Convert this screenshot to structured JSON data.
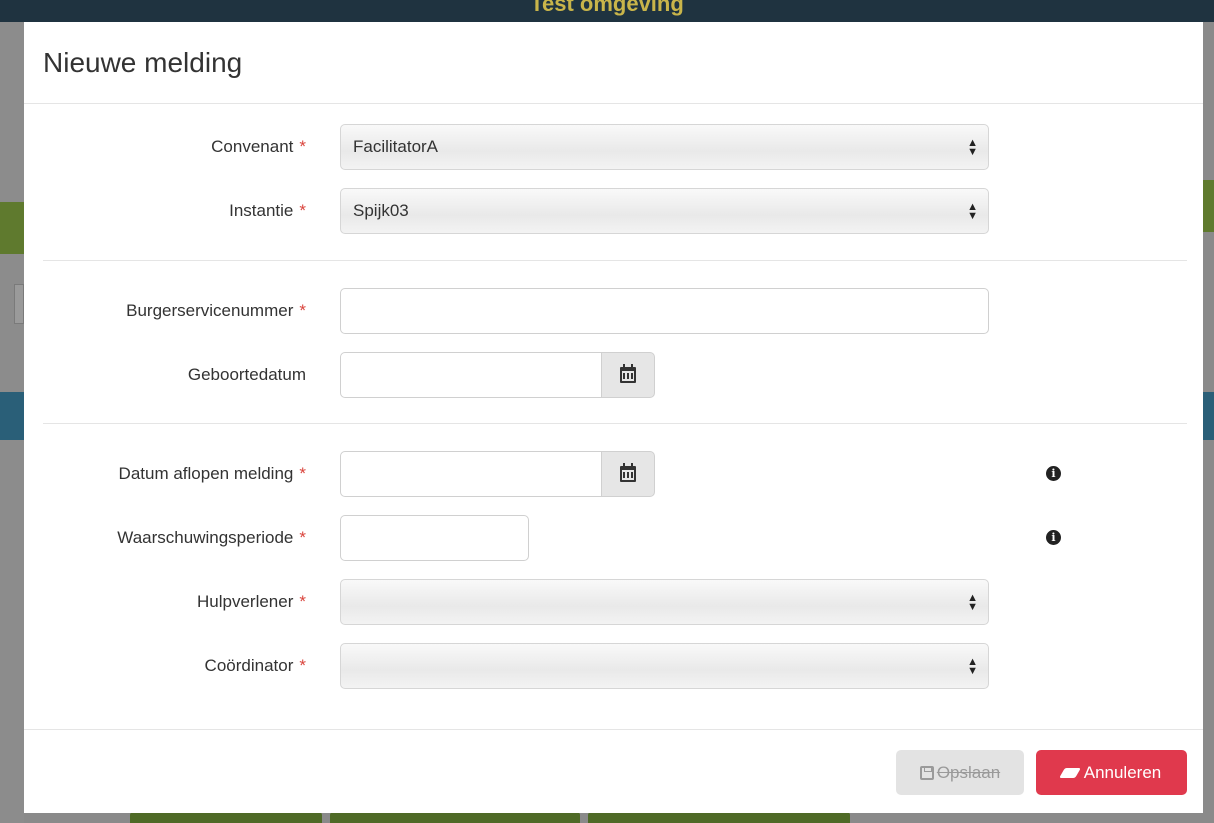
{
  "background": {
    "environment_label": "Test omgeving"
  },
  "modal": {
    "title": "Nieuwe melding",
    "required_marker": "*",
    "fields": {
      "convenant": {
        "label": "Convenant",
        "value": "FacilitatorA"
      },
      "instantie": {
        "label": "Instantie",
        "value": "Spijk03"
      },
      "bsn": {
        "label": "Burgerservicenummer",
        "value": ""
      },
      "geboortedatum": {
        "label": "Geboortedatum",
        "value": ""
      },
      "datum_aflopen": {
        "label": "Datum aflopen melding",
        "value": ""
      },
      "waarschuwingsperiode": {
        "label": "Waarschuwingsperiode",
        "value": ""
      },
      "hulpverlener": {
        "label": "Hulpverlener",
        "value": ""
      },
      "coordinator": {
        "label": "Coördinator",
        "value": ""
      }
    },
    "info_icon_glyph": "i",
    "footer": {
      "save_label": "Opslaan",
      "cancel_label": "Annuleren"
    }
  },
  "colors": {
    "required": "#d9433b",
    "cancel_button": "#e0394d",
    "save_button_disabled": "#e3e3e3"
  },
  "icons": [
    "calendar-icon",
    "info-icon",
    "floppy-disk-icon",
    "eraser-icon",
    "sort-arrows-icon"
  ]
}
